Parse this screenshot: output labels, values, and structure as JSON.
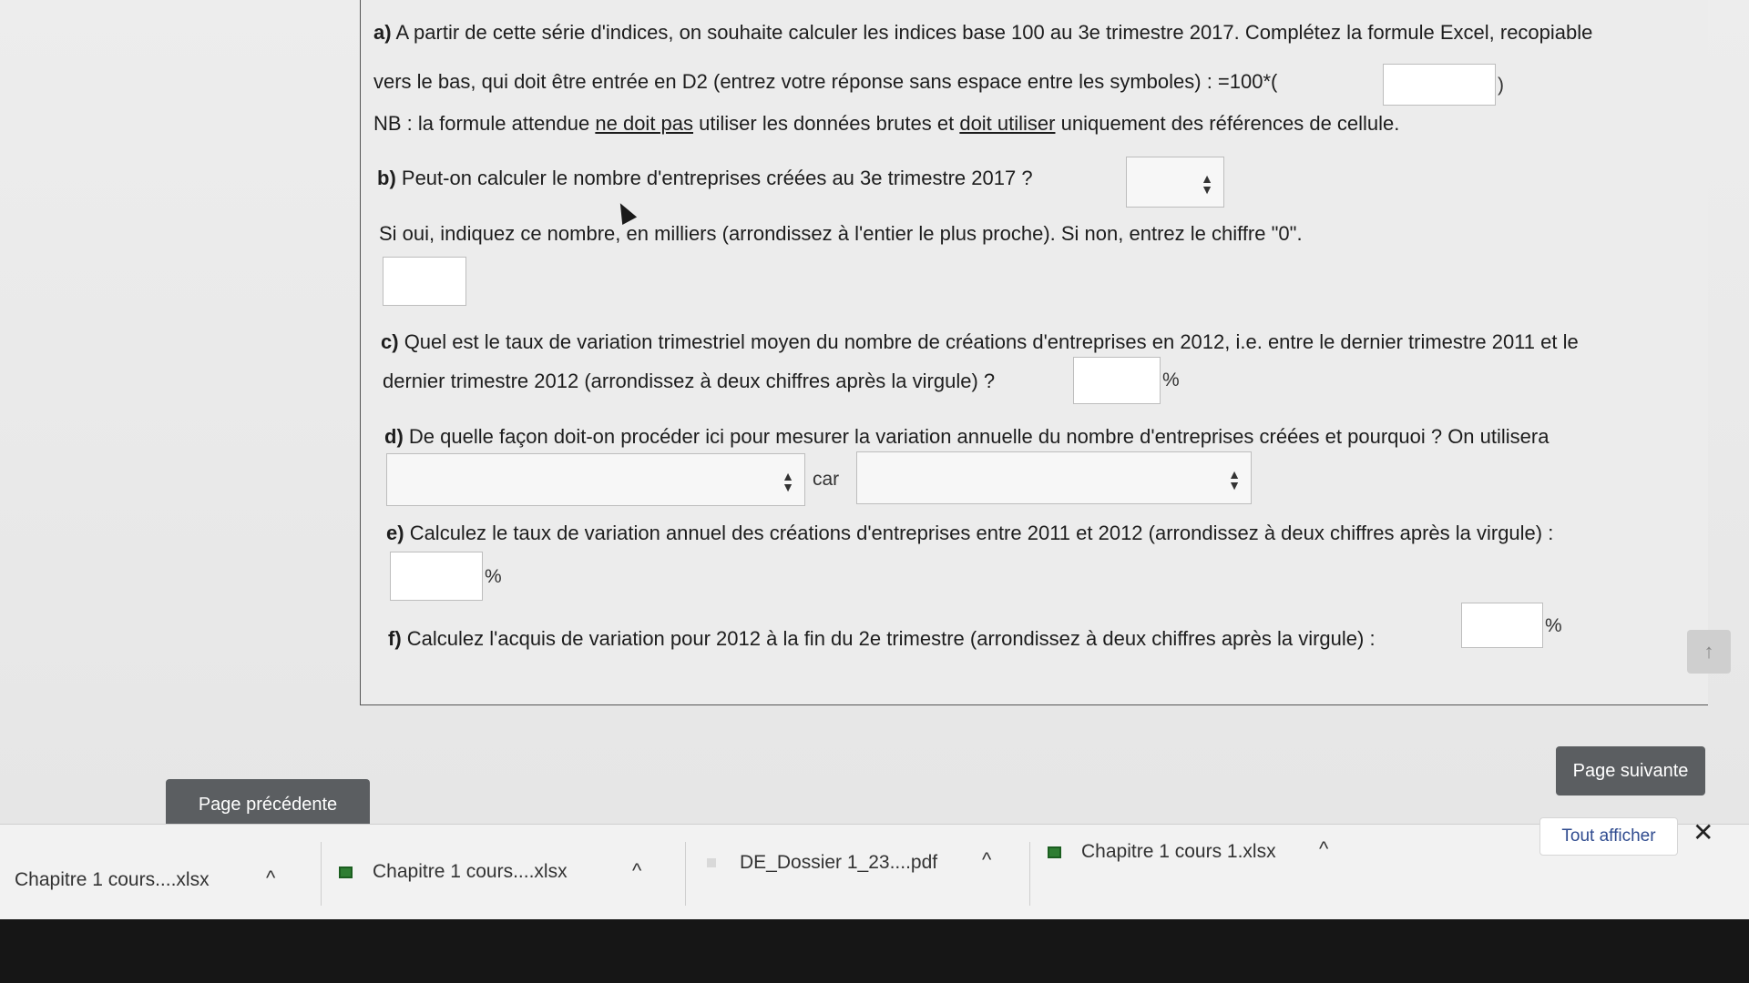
{
  "questions": {
    "a_label": "a)",
    "a_line1": "A partir de cette série d'indices, on souhaite calculer les indices base 100 au 3e trimestre 2017. Complétez la formule Excel, recopiable",
    "a_line2": "vers le bas, qui doit être entrée en D2 (entrez votre réponse sans espace entre les symboles) : =100*(",
    "a_suffix": ")",
    "nb_prefix": "NB : la formule attendue",
    "nb_u1": "ne doit pas",
    "nb_mid": "utiliser les données brutes et",
    "nb_u2": "doit utiliser",
    "nb_end": "uniquement des références de cellule.",
    "b_label": "b)",
    "b_text": "Peut-on calculer le nombre d'entreprises créées au 3e trimestre 2017 ?",
    "b_sub": "Si oui, indiquez ce nombre, en milliers (arrondissez à l'entier le plus proche). Si non, entrez le chiffre \"0\".",
    "c_label": "c)",
    "c_line1": "Quel est le taux de variation trimestriel moyen du nombre de créations d'entreprises en 2012, i.e. entre le dernier trimestre 2011 et le",
    "c_line2": "dernier trimestre 2012 (arrondissez à deux chiffres après la virgule) ?",
    "percent": "%",
    "d_label": "d)",
    "d_text": "De quelle façon doit-on procéder ici pour mesurer la variation annuelle du nombre d'entreprises créées et pourquoi ? On utilisera",
    "d_car": "car",
    "e_label": "e)",
    "e_text": "Calculez le taux de variation annuel des créations d'entreprises entre 2011 et 2012 (arrondissez à deux chiffres après la virgule) :",
    "f_label": "f)",
    "f_text": "Calculez l'acquis de variation pour 2012 à la fin du 2e trimestre (arrondissez à deux chiffres après la virgule) :"
  },
  "select_arrows": "▲▼",
  "nav": {
    "previous": "Page précédente",
    "next": "Page suivante",
    "scroll_top": "↑"
  },
  "downloads": {
    "items": [
      "Chapitre 1 cours....xlsx",
      "Chapitre 1 cours....xlsx",
      "DE_Dossier 1_23....pdf",
      "Chapitre 1 cours 1.xlsx"
    ],
    "chevron": "^",
    "show_all": "Tout afficher",
    "close": "✕"
  }
}
